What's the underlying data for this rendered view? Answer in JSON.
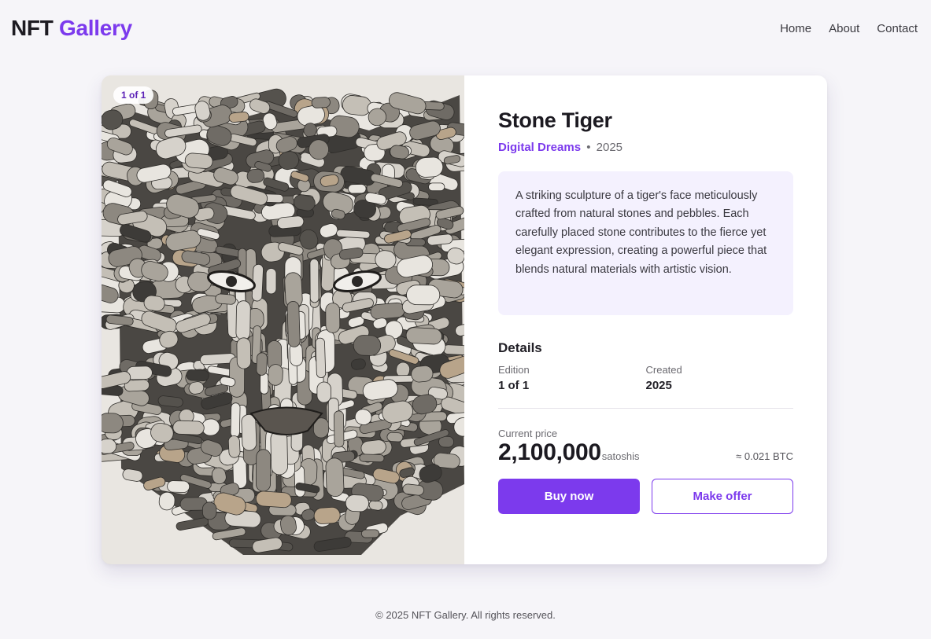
{
  "header": {
    "logo_main": "NFT",
    "logo_accent": "Gallery",
    "nav": [
      "Home",
      "About",
      "Contact"
    ]
  },
  "artwork": {
    "image_subject": "stone tiger sculpture",
    "edition_badge": "1 of 1",
    "title": "Stone Tiger",
    "artist": "Digital Dreams",
    "separator": "•",
    "year": "2025",
    "description": "A striking sculpture of a tiger's face meticulously crafted from natural stones and pebbles. Each carefully placed stone contributes to the fierce yet elegant expression, creating a powerful piece that blends natural materials with artistic vision."
  },
  "details": {
    "heading": "Details",
    "items": [
      {
        "label": "Edition",
        "value": "1 of 1"
      },
      {
        "label": "Created",
        "value": "2025"
      }
    ]
  },
  "price": {
    "label": "Current price",
    "amount": "2,100,000",
    "unit": "satoshis",
    "btc_equivalent": "≈ 0.021 BTC"
  },
  "actions": {
    "buy_label": "Buy now",
    "offer_label": "Make offer"
  },
  "footer": {
    "text": "© 2025 NFT Gallery. All rights reserved."
  },
  "colors": {
    "accent": "#7c3aed",
    "background": "#f6f5f9",
    "description_bg": "#f4f1fe"
  }
}
